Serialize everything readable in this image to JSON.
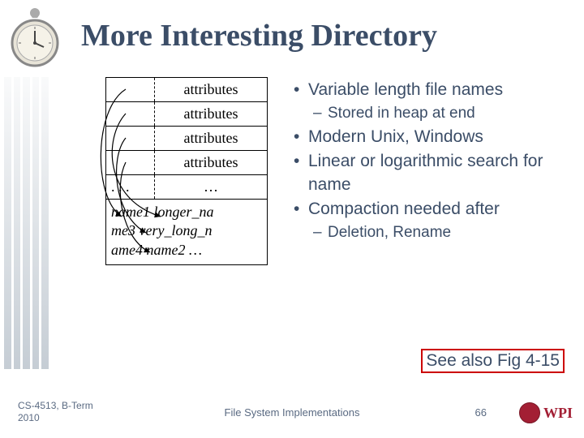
{
  "title": "More Interesting Directory",
  "diagram": {
    "row_label": "attributes",
    "ellipsis_left": ". . .",
    "ellipsis_right": "…",
    "heap_line1": "name1  longer_na",
    "heap_line2": "me3  very_long_n",
    "heap_line3": "ame4 name2 …"
  },
  "bullets": {
    "b1": "Variable length file names",
    "b1a": "Stored in heap at end",
    "b2": "Modern Unix, Windows",
    "b3": "Linear or logarithmic search for name",
    "b4": "Compaction needed after",
    "b4a": "Deletion, Rename"
  },
  "see_also": "See also Fig 4-15",
  "footer": {
    "course": "CS-4513, B-Term 2010",
    "topic": "File System Implementations",
    "page": "66",
    "logo_text": "WPI"
  }
}
